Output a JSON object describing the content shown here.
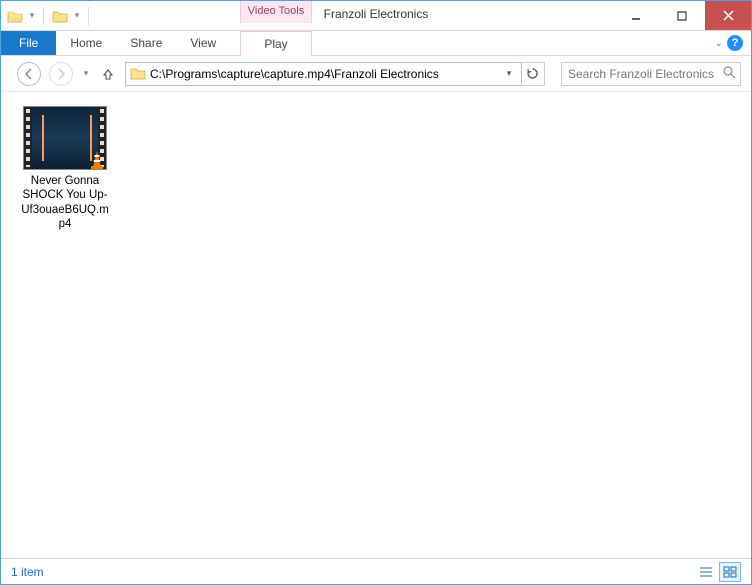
{
  "window": {
    "title": "Franzoli Electronics"
  },
  "contextTab": {
    "group": "Video Tools",
    "tab": "Play"
  },
  "ribbon": {
    "file": "File",
    "tabs": [
      "Home",
      "Share",
      "View"
    ]
  },
  "nav": {
    "address": "C:\\Programs\\capture\\capture.mp4\\Franzoli Electronics",
    "searchPlaceholder": "Search Franzoli Electronics"
  },
  "items": [
    {
      "name": "Never Gonna SHOCK You Up-Uf3ouaeB6UQ.mp4"
    }
  ],
  "status": {
    "count": "1 item"
  }
}
